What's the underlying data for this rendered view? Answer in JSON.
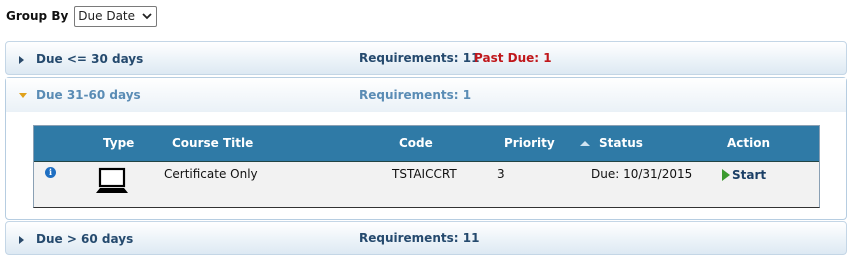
{
  "group_by": {
    "label": "Group By",
    "selected": "Due Date"
  },
  "panels": [
    {
      "title": "Due <= 30 days",
      "requirements": "Requirements: 11",
      "past_due": "Past Due: 1",
      "expanded": false
    },
    {
      "title": "Due 31-60 days",
      "requirements": "Requirements: 1",
      "expanded": true
    },
    {
      "title": "Due > 60 days",
      "requirements": "Requirements: 11",
      "expanded": false
    }
  ],
  "table": {
    "headers": {
      "type": "Type",
      "course_title": "Course Title",
      "code": "Code",
      "priority": "Priority",
      "status": "Status",
      "action": "Action"
    },
    "rows": [
      {
        "type_icon": "laptop-icon",
        "course_title": "Certificate Only",
        "code": "TSTAICCRT",
        "priority": "3",
        "status": "Due: 10/31/2015",
        "action": "Start"
      }
    ]
  },
  "colors": {
    "header_bg": "#2f7aa6",
    "panel_text": "#254a6e",
    "past_due": "#c0171b",
    "start_arrow": "#3b9a2e",
    "expand_arrow": "#e0a11b"
  }
}
